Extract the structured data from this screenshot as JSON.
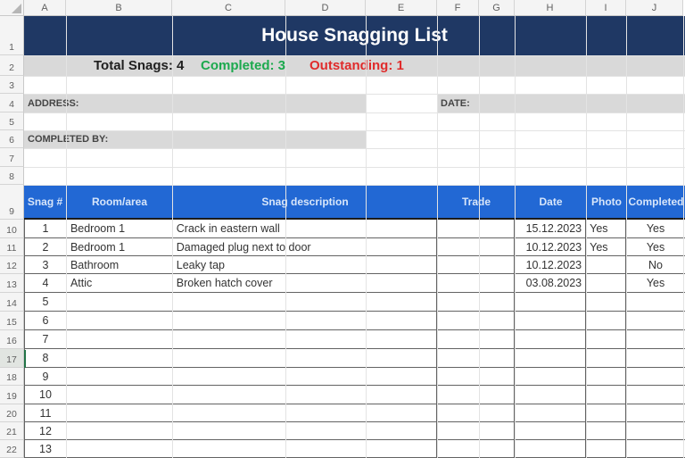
{
  "title": "House Snagging List",
  "summary": {
    "total": "Total Snags: 4",
    "completed": "Completed: 3",
    "outstanding": "Outstanding: 1"
  },
  "form": {
    "address_label": "ADDRESS:",
    "address_value": "",
    "date_label": "DATE:",
    "date_value": "",
    "completed_by_label": "COMPLETED BY:",
    "completed_by_value": ""
  },
  "grid": {
    "columns": [
      "A",
      "B",
      "C",
      "D",
      "E",
      "F",
      "G",
      "H",
      "I",
      "J"
    ],
    "rows": [
      "1",
      "2",
      "3",
      "4",
      "5",
      "6",
      "7",
      "8",
      "9",
      "10",
      "11",
      "12",
      "13",
      "14",
      "15",
      "16",
      "17",
      "18",
      "19",
      "20",
      "21",
      "22"
    ],
    "selected_cell": "A17",
    "selected_row_header": "17"
  },
  "table": {
    "headers": [
      "Snag #",
      "Room/area",
      "Snag description",
      "Trade",
      "Date",
      "Photo",
      "Completed"
    ],
    "rows": [
      {
        "snag": "1",
        "room": "Bedroom 1",
        "description": "Crack in eastern wall",
        "trade": "",
        "date": "15.12.2023",
        "photo": "Yes",
        "completed": "Yes"
      },
      {
        "snag": "2",
        "room": "Bedroom 1",
        "description": "Damaged plug next to door",
        "trade": "",
        "date": "10.12.2023",
        "photo": "Yes",
        "completed": "Yes"
      },
      {
        "snag": "3",
        "room": "Bathroom",
        "description": "Leaky tap",
        "trade": "",
        "date": "10.12.2023",
        "photo": "",
        "completed": "No"
      },
      {
        "snag": "4",
        "room": "Attic",
        "description": "Broken hatch cover",
        "trade": "",
        "date": "03.08.2023",
        "photo": "",
        "completed": "Yes"
      },
      {
        "snag": "5",
        "room": "",
        "description": "",
        "trade": "",
        "date": "",
        "photo": "",
        "completed": ""
      },
      {
        "snag": "6",
        "room": "",
        "description": "",
        "trade": "",
        "date": "",
        "photo": "",
        "completed": ""
      },
      {
        "snag": "7",
        "room": "",
        "description": "",
        "trade": "",
        "date": "",
        "photo": "",
        "completed": ""
      },
      {
        "snag": "8",
        "room": "",
        "description": "",
        "trade": "",
        "date": "",
        "photo": "",
        "completed": ""
      },
      {
        "snag": "9",
        "room": "",
        "description": "",
        "trade": "",
        "date": "",
        "photo": "",
        "completed": ""
      },
      {
        "snag": "10",
        "room": "",
        "description": "",
        "trade": "",
        "date": "",
        "photo": "",
        "completed": ""
      },
      {
        "snag": "11",
        "room": "",
        "description": "",
        "trade": "",
        "date": "",
        "photo": "",
        "completed": ""
      },
      {
        "snag": "12",
        "room": "",
        "description": "",
        "trade": "",
        "date": "",
        "photo": "",
        "completed": ""
      },
      {
        "snag": "13",
        "room": "",
        "description": "",
        "trade": "",
        "date": "",
        "photo": "",
        "completed": ""
      }
    ]
  },
  "colors": {
    "title_bar": "#1F3864",
    "band_gray": "#D9D9D9",
    "table_header_blue": "#2268D4",
    "completed_green": "#1CA94E",
    "outstanding_red": "#E02B2B",
    "selection_green": "#217346",
    "table_border": "#636363"
  }
}
